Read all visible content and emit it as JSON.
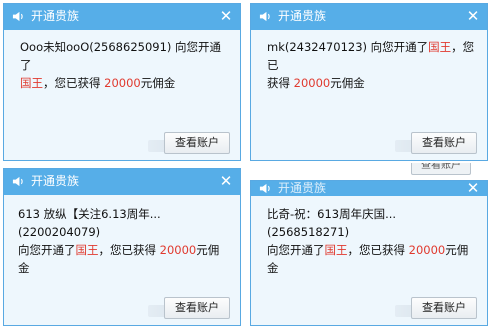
{
  "popups": [
    {
      "title": "开通贵族",
      "line1": "Ooo未知ooO(2568625091) 向您开通了",
      "noble": "国王",
      "mid": "，您已获得 ",
      "amount": "20000",
      "suffix": "元佣金",
      "button": "查看账户"
    },
    {
      "title": "开通贵族",
      "line1": "mk(2432470123) 向您开通了",
      "noble": "国王",
      "mid": "，您已",
      "line2_prefix": "获得 ",
      "amount": "20000",
      "suffix": "元佣金",
      "button": "查看账户"
    },
    {
      "title": "开通贵族",
      "line1": "613 放纵【关注6.13周年...(2200204079)",
      "prefix": "向您开通了",
      "noble": "国王",
      "mid": "，您已获得 ",
      "amount": "20000",
      "suffix": "元佣金",
      "button": "查看账户"
    },
    {
      "title": "开通贵族",
      "line1": "比奇-祝：613周年庆国...(2568518271)",
      "prefix": "向您开通了",
      "noble": "国王",
      "mid": "，您已获得 ",
      "amount": "20000",
      "suffix": "元佣金",
      "button": "查看账户"
    }
  ],
  "obscured_button": "查看账户",
  "colors": {
    "titlebar": "#56aee8",
    "border": "#59a9e2",
    "body": "#eef7fd",
    "highlight": "#e03a2f"
  },
  "icons": [
    "speaker-icon",
    "close-icon"
  ]
}
